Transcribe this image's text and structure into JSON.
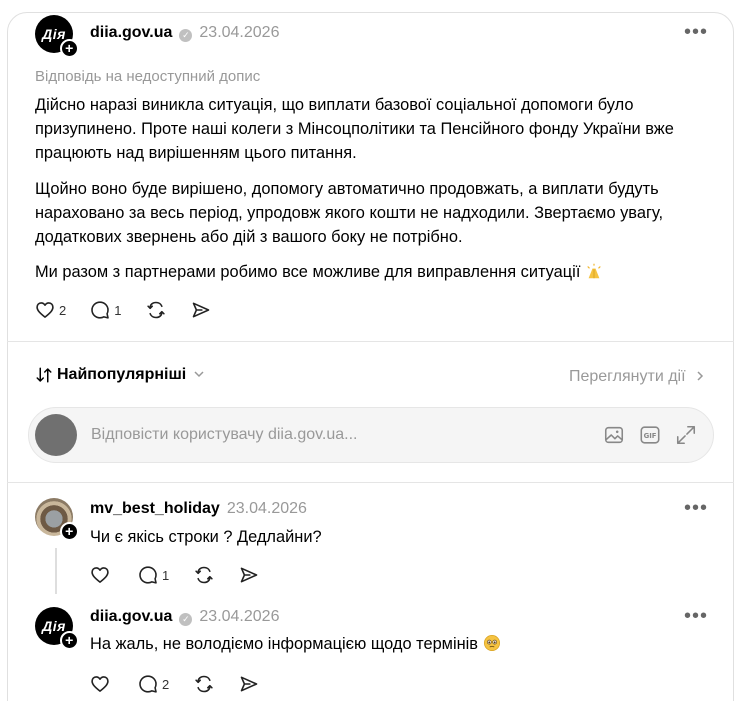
{
  "post": {
    "avatar_text": "Дія",
    "username": "diia.gov.ua",
    "date": "23.04.2026",
    "reply_to": "Відповідь на недоступний допис",
    "paragraphs": [
      "Дійсно наразі виникла ситуація, що виплати базової соціальної допомоги було призупинено. Проте наші колеги з Мінсоцполітики та Пенсійного фонду України вже працюють над вирішенням цього питання.",
      "Щойно воно буде вирішено, допомогу автоматично продовжать, а виплати будуть нараховано за весь період, упродовж якого кошти не надходили. Звертаємо увагу, додаткових звернень або дій з вашого боку не потрібно.",
      "Ми разом з партнерами робимо все можливе для виправлення ситуації"
    ],
    "likes": "2",
    "replies": "1"
  },
  "sort": {
    "label": "Найпопулярніші",
    "view_activity": "Переглянути дії"
  },
  "reply_box": {
    "placeholder": "Відповісти користувачу diia.gov.ua..."
  },
  "comments": [
    {
      "username": "mv_best_holiday",
      "date": "23.04.2026",
      "text": "Чи є якісь строки ? Дедлайни?",
      "likes": "",
      "replies": "1"
    },
    {
      "avatar_text": "Дія",
      "username": "diia.gov.ua",
      "date": "23.04.2026",
      "text": "На жаль, не володіємо інформацією щодо термінів",
      "likes": "",
      "replies": "2"
    }
  ],
  "icons": {
    "post_more": "more-icon",
    "verified": "verified-icon",
    "like": "heart-icon",
    "reply": "comment-icon",
    "repost": "repost-icon",
    "share": "send-icon",
    "sort": "sort-arrows-icon",
    "image": "image-icon",
    "gif": "gif-icon",
    "expand": "expand-icon",
    "prayer_emoji": "folded-hands-emoji",
    "sad_emoji": "pleading-face-emoji"
  },
  "colors": {
    "text": "#000000",
    "muted": "#999999",
    "border": "#e0e0e0",
    "reply_box_bg": "#f5f5f5"
  }
}
